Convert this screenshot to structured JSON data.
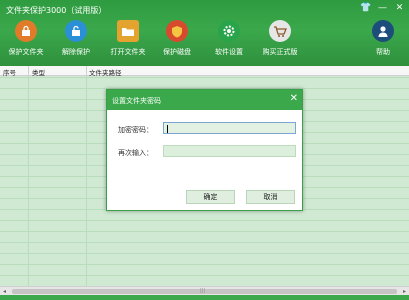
{
  "app": {
    "title": "文件夹保护3000（试用版）"
  },
  "window_controls": {
    "skin": "👕",
    "minimize": "—",
    "close": "✕"
  },
  "toolbar": {
    "items": [
      {
        "label": "保护文件夹",
        "icon": "lock-icon",
        "color": "#e07b2a"
      },
      {
        "label": "解除保护",
        "icon": "unlock-icon",
        "color": "#2b8fd6"
      },
      {
        "label": "打开文件夹",
        "icon": "folder-icon",
        "color": "#e4a22e"
      },
      {
        "label": "保护磁盘",
        "icon": "shield-icon",
        "color": "#d84a2d"
      },
      {
        "label": "软件设置",
        "icon": "gear-icon",
        "color": "#29a44a"
      },
      {
        "label": "购买正式版",
        "icon": "cart-icon",
        "color": "#e6e6e6"
      },
      {
        "label": "帮助",
        "icon": "user-help-icon",
        "color": "#1d4d7a"
      }
    ]
  },
  "table": {
    "columns": [
      "序号",
      "类型",
      "文件夹路径"
    ]
  },
  "dialog": {
    "title": "设置文件夹密码",
    "close": "✕",
    "password_label": "加密密码：",
    "password_value": "",
    "confirm_label": "再次输入：",
    "confirm_value": "",
    "ok_label": "确定",
    "cancel_label": "取消"
  },
  "scrollbar": {
    "left_arrow": "◂",
    "right_arrow": "▸",
    "grip": "|||"
  }
}
